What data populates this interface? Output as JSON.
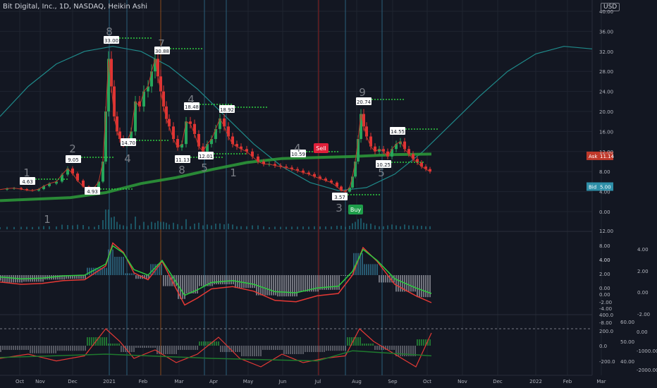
{
  "header": {
    "symbol_title": "Bit Digital, Inc., 1D, NASDAQ, Heikin Ashi",
    "currency": "USD"
  },
  "colors": {
    "background": "#131722",
    "grid": "#1f2430",
    "axis_text": "#b2b5be",
    "bull": "#26a65b",
    "bear": "#e03434",
    "ma_long": "#2e9e3a",
    "wave": "#1f8a8a",
    "ask": "#c0392b",
    "bid": "#2e8fa8",
    "sell": "#e0203a",
    "buy": "#1e9e4a"
  },
  "chart_data": {
    "type": "line",
    "x_tick_labels": [
      "Oct",
      "Nov",
      "Dec",
      "2021",
      "Feb",
      "Mar",
      "Apr",
      "May",
      "Jun",
      "Jul",
      "Aug",
      "Sep",
      "Oct",
      "Nov",
      "Dec",
      "2022",
      "Feb",
      "Mar"
    ],
    "main_panel": {
      "ylim": [
        0,
        42
      ],
      "y_tick_labels": [
        "40.00",
        "36.00",
        "32.00",
        "28.00",
        "24.00",
        "20.00",
        "16.00",
        "12.00",
        "8.00",
        "4.00",
        "0.00"
      ],
      "series": [
        {
          "style": "heikin-ashi-close",
          "x": [
            0,
            10,
            20,
            30,
            38,
            46,
            55,
            62,
            70,
            80,
            88,
            96,
            103,
            110,
            118,
            126,
            134,
            140,
            146,
            150,
            154,
            158,
            162,
            166,
            170,
            175,
            180,
            186,
            192,
            198,
            204,
            210,
            215,
            220,
            224,
            228,
            232,
            236,
            240,
            246,
            252,
            258,
            264,
            270,
            276,
            282,
            288,
            294,
            300,
            306,
            312,
            318,
            324,
            330,
            336,
            342,
            350,
            358,
            366,
            374,
            382,
            390,
            398,
            406,
            414,
            422,
            430,
            438,
            446,
            454,
            462,
            470,
            478,
            484,
            490,
            496,
            500,
            504,
            508,
            512,
            516,
            520,
            526,
            532,
            538,
            544,
            550,
            556,
            562,
            568,
            574,
            580,
            586,
            592,
            598,
            604,
            610
          ],
          "values": [
            4.4,
            4.6,
            4.7,
            4.5,
            4.3,
            4.2,
            4.5,
            5.1,
            5.6,
            6.0,
            7.4,
            8.6,
            7.6,
            6.2,
            5.0,
            4.6,
            4.8,
            6.0,
            10.0,
            20.0,
            30.5,
            25.0,
            19.0,
            16.0,
            14.5,
            13.5,
            14.0,
            16.0,
            22.0,
            21.0,
            24.0,
            25.0,
            28.0,
            30.5,
            27.0,
            24.0,
            21.0,
            18.5,
            17.0,
            14.5,
            12.8,
            13.5,
            18.0,
            17.5,
            15.5,
            13.0,
            12.0,
            13.5,
            14.5,
            16.5,
            18.6,
            17.0,
            15.0,
            13.5,
            13.0,
            12.5,
            12.0,
            11.0,
            10.0,
            9.5,
            9.5,
            9.2,
            9.0,
            8.8,
            8.5,
            8.2,
            7.8,
            7.5,
            7.0,
            6.6,
            6.2,
            5.8,
            5.0,
            4.2,
            4.0,
            4.8,
            7.0,
            10.0,
            14.5,
            19.5,
            17.0,
            15.0,
            13.0,
            12.0,
            12.5,
            12.0,
            11.0,
            12.5,
            13.5,
            14.0,
            12.5,
            11.5,
            10.5,
            9.8,
            9.0,
            8.5,
            8.0,
            7.8
          ]
        },
        {
          "style": "long-moving-average",
          "x": [
            0,
            100,
            150,
            200,
            250,
            300,
            350,
            400,
            450,
            500,
            560,
            612
          ],
          "values": [
            2.2,
            2.8,
            3.8,
            5.6,
            6.8,
            8.4,
            9.8,
            10.6,
            10.8,
            11.0,
            11.4,
            11.5
          ]
        },
        {
          "style": "cycle-wave",
          "x": [
            0,
            40,
            80,
            120,
            160,
            200,
            240,
            280,
            320,
            360,
            400,
            440,
            480,
            520,
            560,
            600,
            640,
            680,
            720,
            760,
            800,
            840
          ],
          "values": [
            19,
            25,
            29.5,
            32,
            33,
            32,
            29,
            24.5,
            19,
            13.5,
            9,
            5.8,
            4.2,
            4.8,
            7.5,
            12,
            17.5,
            23,
            28,
            31.5,
            33,
            32.5
          ]
        }
      ],
      "price_labels": [
        "4.63",
        "9.05",
        "4.93",
        "33.00",
        "30.88",
        "14.70",
        "18.48",
        "11.13",
        "12.01",
        "18.92",
        "10.59",
        "3.57",
        "20.74",
        "10.25",
        "14.55"
      ],
      "wave_count_labels": [
        "1",
        "2",
        "1",
        "8",
        "7",
        "4",
        "4",
        "8",
        "5",
        "1",
        "4",
        "3",
        "9",
        "5"
      ],
      "signals": {
        "sell": "Sell",
        "buy": "Buy"
      },
      "last_prices": {
        "ask_label": "Ask",
        "ask": "11.14",
        "bid_label": "Bid",
        "bid": "5.00"
      },
      "volume_axis_label": "12.00"
    },
    "oscillator_panel": {
      "y_tick_labels_left": [
        "4.00",
        "0.00",
        "-4.00",
        "-8.00"
      ],
      "y_tick_labels_mid": [
        "8.00",
        "4.00",
        "2.00",
        "0.00",
        "-2.00"
      ],
      "y_tick_labels_right": [
        "4.00",
        "2.00",
        "0.00",
        "-2.00"
      ],
      "series": [
        {
          "name": "",
          "x": [
            0,
            30,
            60,
            90,
            120,
            150,
            160,
            175,
            190,
            210,
            230,
            250,
            262,
            280,
            300,
            330,
            360,
            390,
            420,
            450,
            480,
            500,
            515,
            535,
            560,
            590,
            612
          ],
          "values": [
            -1.5,
            -2.0,
            -1.8,
            -1.2,
            -1.0,
            2.0,
            7.0,
            5.0,
            0.5,
            -1.0,
            3.0,
            -3.0,
            -6.5,
            -5.0,
            -3.0,
            -2.5,
            -3.5,
            -5.5,
            -5.8,
            -4.5,
            -4.0,
            0.0,
            6.0,
            3.0,
            -2.0,
            -4.5,
            -6.0
          ]
        }
      ]
    },
    "indicator_panel": {
      "y_tick_labels_left": [
        "400.0",
        "200.0",
        "0.0",
        "-200.0"
      ],
      "y_tick_labels_mid": [
        "60.00",
        "50.00",
        "40.00"
      ],
      "y_tick_labels_right": [
        "0.00",
        "-1000.00",
        "-2000.00"
      ],
      "series": [
        {
          "name": "",
          "x": [
            0,
            40,
            80,
            120,
            150,
            170,
            190,
            220,
            250,
            280,
            310,
            340,
            370,
            400,
            430,
            460,
            490,
            510,
            530,
            560,
            590,
            612
          ],
          "values": [
            -150,
            -100,
            -180,
            -120,
            200,
            50,
            -150,
            -50,
            -200,
            -100,
            100,
            -150,
            -250,
            -100,
            -200,
            -150,
            -120,
            200,
            50,
            -100,
            -250,
            150
          ]
        }
      ]
    }
  }
}
